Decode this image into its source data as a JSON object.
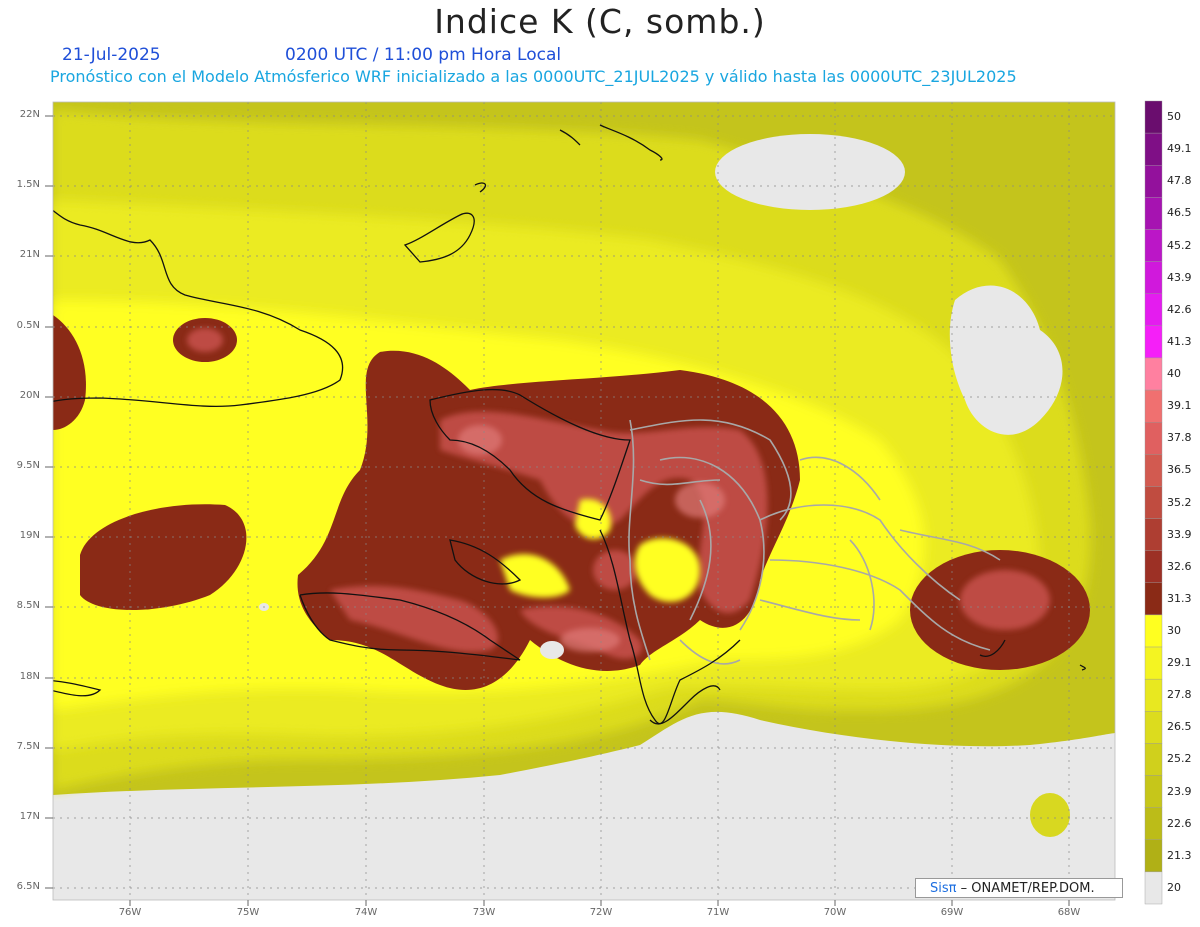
{
  "header": {
    "title": "Indice K (C, somb.)",
    "date": "21-Jul-2025",
    "time": "0200 UTC / 11:00 pm Hora Local",
    "model_info": "Pronóstico con el Modelo Atmósferico WRF inicializado a las 0000UTC_21JUL2025 y válido hasta las  0000UTC_23JUL2025"
  },
  "map": {
    "lat_labels": [
      "22N",
      "1.5N",
      "21N",
      "0.5N",
      "20N",
      "9.5N",
      "19N",
      "8.5N",
      "18N",
      "7.5N",
      "17N",
      "6.5N"
    ],
    "lon_labels": [
      "76W",
      "75W",
      "74W",
      "73W",
      "72W",
      "71W",
      "70W",
      "69W",
      "68W"
    ]
  },
  "colorbar": {
    "labels": [
      "50",
      "49.1",
      "47.8",
      "46.5",
      "45.2",
      "43.9",
      "42.6",
      "41.3",
      "40",
      "39.1",
      "37.8",
      "36.5",
      "35.2",
      "33.9",
      "32.6",
      "31.3",
      "30",
      "29.1",
      "27.8",
      "26.5",
      "25.2",
      "23.9",
      "22.6",
      "21.3",
      "20"
    ],
    "colors": [
      "#6a0d6e",
      "#7f0f86",
      "#93119c",
      "#a613b1",
      "#bb16c7",
      "#d019dc",
      "#e41cef",
      "#f51ff8",
      "#ff80a0",
      "#f07070",
      "#e06060",
      "#d25a50",
      "#c04c40",
      "#ae3e32",
      "#9c3025",
      "#8a2a16",
      "#ffff20",
      "#f4f422",
      "#e8e820",
      "#dcdc1e",
      "#d0d01c",
      "#c6c61a",
      "#bcbc18",
      "#b0b016",
      "#e8e8e8"
    ]
  },
  "credit": {
    "brand": "Sisπ",
    "text": "– ONAMET/REP.DOM."
  }
}
